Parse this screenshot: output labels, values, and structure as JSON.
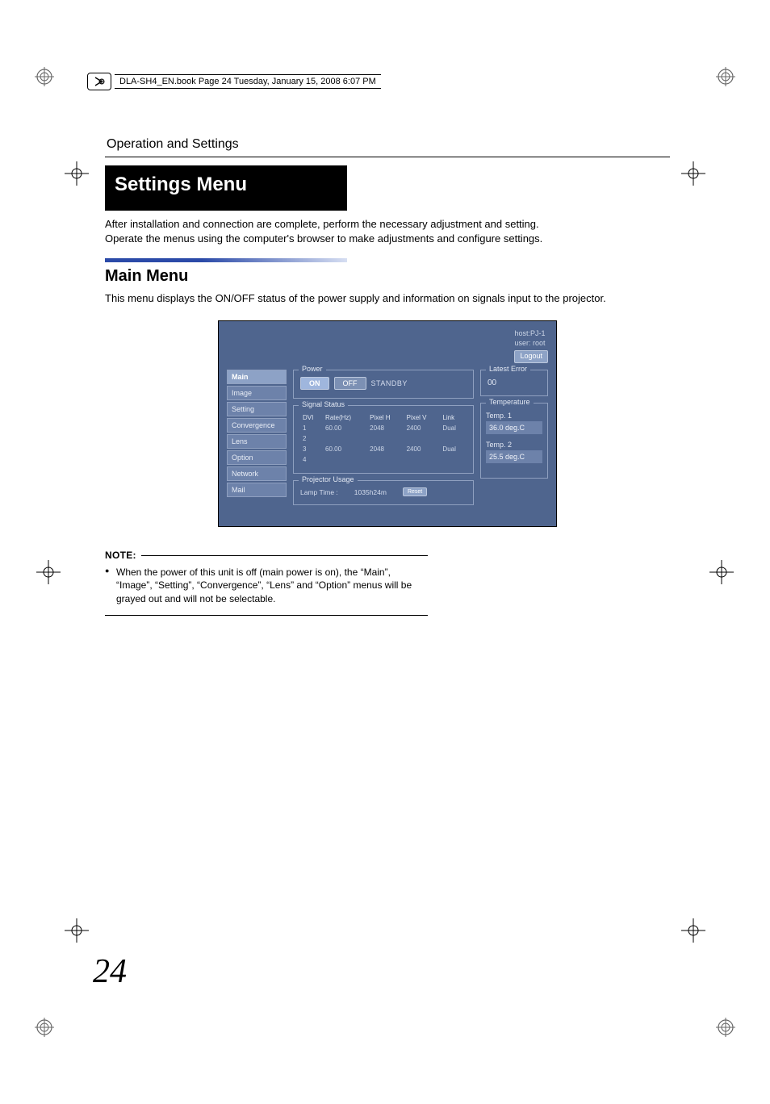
{
  "book_header": "DLA-SH4_EN.book  Page 24  Tuesday, January 15, 2008  6:07 PM",
  "section_title": "Operation and Settings",
  "settings_menu_title": "Settings Menu",
  "intro_line1": "After installation and connection are complete, perform the necessary adjustment and setting.",
  "intro_line2": "Operate the menus using the computer's browser to make adjustments and configure settings.",
  "main_menu_heading": "Main Menu",
  "main_menu_desc": "This menu displays the ON/OFF status of the power supply and information on signals input to the projector.",
  "shot": {
    "meta_host": "host:PJ-1",
    "meta_user": "user: root",
    "logout": "Logout",
    "nav": {
      "main": "Main",
      "image": "Image",
      "setting": "Setting",
      "convergence": "Convergence",
      "lens": "Lens",
      "option": "Option",
      "network": "Network",
      "mail": "Mail"
    },
    "power": {
      "legend": "Power",
      "on": "ON",
      "off": "OFF",
      "standby": "STANDBY"
    },
    "signal": {
      "legend": "Signal Status",
      "cols": {
        "dvi": "DVI",
        "rate": "Rate(Hz)",
        "ph": "Pixel H",
        "pv": "Pixel V",
        "link": "Link"
      },
      "rows": [
        {
          "dvi": "1",
          "rate": "60.00",
          "ph": "2048",
          "pv": "2400",
          "link": "Dual"
        },
        {
          "dvi": "2",
          "rate": "",
          "ph": "",
          "pv": "",
          "link": ""
        },
        {
          "dvi": "3",
          "rate": "60.00",
          "ph": "2048",
          "pv": "2400",
          "link": "Dual"
        },
        {
          "dvi": "4",
          "rate": "",
          "ph": "",
          "pv": "",
          "link": ""
        }
      ]
    },
    "usage": {
      "legend": "Projector Usage",
      "lamp_label": "Lamp Time :",
      "lamp_value": "1035h24m",
      "reset": "Reset"
    },
    "error": {
      "legend": "Latest Error",
      "code": "00"
    },
    "temp": {
      "legend": "Temperature",
      "t1_label": "Temp. 1",
      "t1_value": "36.0 deg.C",
      "t2_label": "Temp. 2",
      "t2_value": "25.5 deg.C"
    }
  },
  "note": {
    "label": "NOTE:",
    "text": "When the power of this unit is off (main power is on), the “Main”, “Image”, “Setting”, “Convergence”, “Lens” and “Option” menus will be grayed out and will not be selectable."
  },
  "page_number": "24"
}
